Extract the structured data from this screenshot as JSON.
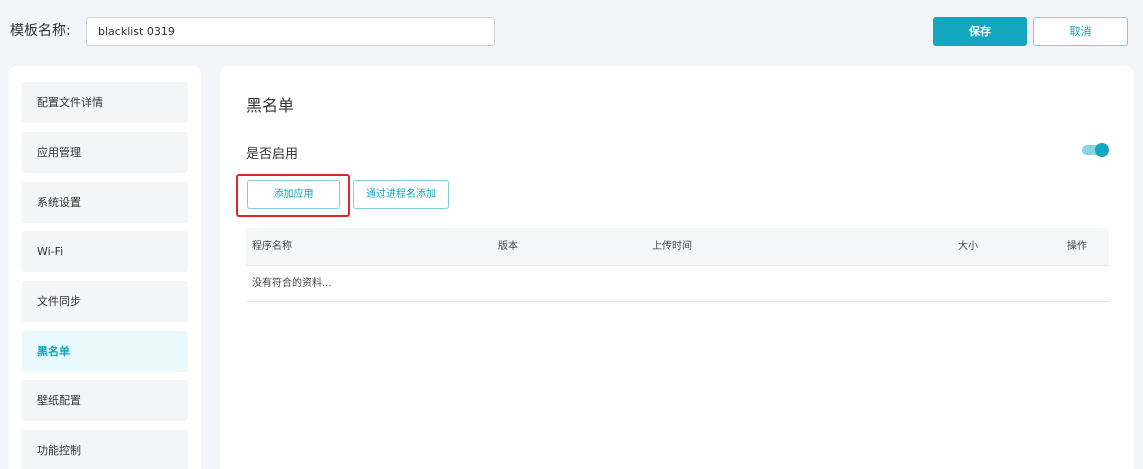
{
  "header": {
    "template_name_label": "模板名称:",
    "template_name_value": "blacklist 0319",
    "save_label": "保存",
    "cancel_label": "取消"
  },
  "sidebar": {
    "items": [
      {
        "label": "配置文件详情",
        "active": false
      },
      {
        "label": "应用管理",
        "active": false
      },
      {
        "label": "系统设置",
        "active": false
      },
      {
        "label": "Wi-Fi",
        "active": false
      },
      {
        "label": "文件同步",
        "active": false
      },
      {
        "label": "黑名单",
        "active": true
      },
      {
        "label": "壁纸配置",
        "active": false
      },
      {
        "label": "功能控制",
        "active": false
      }
    ]
  },
  "main": {
    "title": "黑名单",
    "enable_label": "是否启用",
    "enabled": true,
    "add_app_label": "添加应用",
    "add_by_process_label": "通过进程名添加",
    "table": {
      "columns": [
        "程序名称",
        "版本",
        "上传时间",
        "大小",
        "操作"
      ],
      "empty_text": "没有符合的资料..."
    }
  },
  "colors": {
    "accent": "#12a6bf",
    "highlight_box": "#e0262b",
    "background": "#f3f5f8"
  }
}
